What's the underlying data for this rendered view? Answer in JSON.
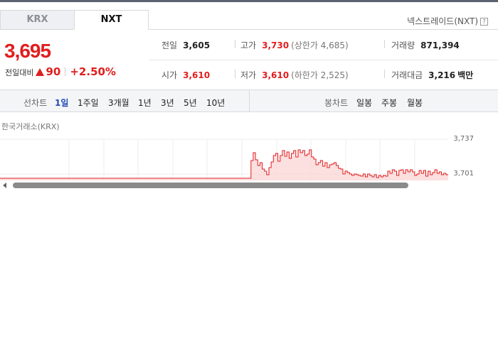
{
  "tabs": [
    {
      "label": "KRX",
      "active": false
    },
    {
      "label": "NXT",
      "active": true
    }
  ],
  "trade_label": "넥스트레이드(NXT)",
  "help_glyph": "?",
  "price": {
    "current": "3,695",
    "change_label": "전일대비",
    "change": "90",
    "change_rate": "+2.50%"
  },
  "stats": {
    "prev_close": {
      "label": "전일",
      "value": "3,605"
    },
    "high": {
      "label": "고가",
      "value": "3,730",
      "sub": "(상한가 4,685)"
    },
    "volume": {
      "label": "거래량",
      "value": "871,394"
    },
    "open": {
      "label": "시가",
      "value": "3,610"
    },
    "low": {
      "label": "저가",
      "value": "3,610",
      "sub": "(하한가 2,525)"
    },
    "amount": {
      "label": "거래대금",
      "value": "3,216",
      "unit": "백만"
    }
  },
  "period_bar": {
    "line_label": "선차트",
    "line_items": [
      "1일",
      "1주일",
      "3개월",
      "1년",
      "3년",
      "5년",
      "10년"
    ],
    "active": "1일",
    "candle_label": "봉차트",
    "candle_items": [
      "일봉",
      "주봉",
      "월봉"
    ]
  },
  "market_label": "한국거래소(KRX)",
  "colors": {
    "up": "#e01e1e",
    "active_period": "#1f4ab4"
  },
  "chart_data": {
    "type": "area",
    "y_ticks": [
      "3,737",
      "3,701"
    ],
    "ylim": [
      3685,
      3745
    ],
    "xlim": [
      0,
      100
    ],
    "x": [
      0,
      55.5,
      56,
      56.5,
      57,
      57.5,
      58,
      58.5,
      59,
      59.5,
      60,
      60.5,
      61,
      61.5,
      62,
      62.5,
      63,
      63.5,
      64,
      64.5,
      65,
      65.5,
      66,
      66.5,
      67,
      67.5,
      68,
      68.5,
      69,
      69.5,
      70,
      70.5,
      71,
      71.5,
      72,
      72.5,
      73,
      73.5,
      74,
      74.5,
      75,
      75.5,
      76,
      76.5,
      77,
      77.5,
      78,
      78.5,
      79,
      79.5,
      80,
      80.5,
      81,
      81.5,
      82,
      82.5,
      83,
      83.5,
      84,
      84.5,
      85,
      85.5,
      86,
      86.5,
      87,
      87.5,
      88,
      88.5,
      89,
      89.5,
      90,
      90.5,
      91,
      91.5,
      92,
      92.5,
      93,
      93.5,
      94,
      94.5,
      95,
      95.5,
      96,
      96.5,
      97,
      97.5,
      98,
      98.5,
      99,
      99.5,
      100
    ],
    "values": [
      3690,
      3690,
      3715,
      3726,
      3716,
      3708,
      3712,
      3703,
      3700,
      3695,
      3705,
      3713,
      3722,
      3725,
      3714,
      3722,
      3729,
      3721,
      3727,
      3718,
      3725,
      3729,
      3720,
      3730,
      3726,
      3729,
      3722,
      3724,
      3730,
      3720,
      3717,
      3709,
      3712,
      3715,
      3707,
      3712,
      3705,
      3709,
      3710,
      3712,
      3708,
      3704,
      3703,
      3696,
      3700,
      3698,
      3696,
      3694,
      3696,
      3695,
      3694,
      3693,
      3696,
      3692,
      3696,
      3694,
      3692,
      3695,
      3691,
      3694,
      3692,
      3694,
      3693,
      3700,
      3697,
      3702,
      3700,
      3694,
      3701,
      3702,
      3697,
      3702,
      3699,
      3702,
      3699,
      3694,
      3696,
      3701,
      3697,
      3701,
      3693,
      3700,
      3695,
      3698,
      3702,
      3697,
      3699,
      3695,
      3697,
      3695,
      3695
    ]
  }
}
